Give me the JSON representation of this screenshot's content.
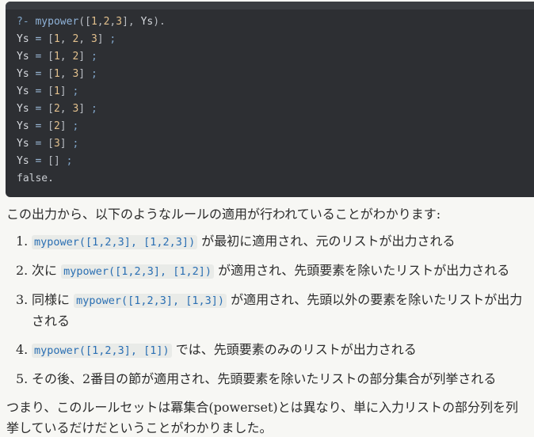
{
  "code": {
    "lines": [
      [
        {
          "c": "tk-prompt",
          "t": "?- "
        },
        {
          "c": "tk-fn",
          "t": "mypower"
        },
        {
          "c": "tk-punc",
          "t": "(["
        },
        {
          "c": "tk-num",
          "t": "1"
        },
        {
          "c": "tk-punc",
          "t": ","
        },
        {
          "c": "tk-num",
          "t": "2"
        },
        {
          "c": "tk-punc",
          "t": ","
        },
        {
          "c": "tk-num",
          "t": "3"
        },
        {
          "c": "tk-punc",
          "t": "], "
        },
        {
          "c": "tk-var",
          "t": "Ys"
        },
        {
          "c": "tk-punc",
          "t": ")."
        }
      ],
      [
        {
          "c": "tk-var",
          "t": "Ys"
        },
        {
          "c": "tk-op",
          "t": " = "
        },
        {
          "c": "tk-punc",
          "t": "["
        },
        {
          "c": "tk-num",
          "t": "1"
        },
        {
          "c": "tk-punc",
          "t": ", "
        },
        {
          "c": "tk-num",
          "t": "2"
        },
        {
          "c": "tk-punc",
          "t": ", "
        },
        {
          "c": "tk-num",
          "t": "3"
        },
        {
          "c": "tk-punc",
          "t": "] "
        },
        {
          "c": "tk-semi",
          "t": ";"
        }
      ],
      [
        {
          "c": "tk-var",
          "t": "Ys"
        },
        {
          "c": "tk-op",
          "t": " = "
        },
        {
          "c": "tk-punc",
          "t": "["
        },
        {
          "c": "tk-num",
          "t": "1"
        },
        {
          "c": "tk-punc",
          "t": ", "
        },
        {
          "c": "tk-num",
          "t": "2"
        },
        {
          "c": "tk-punc",
          "t": "] "
        },
        {
          "c": "tk-semi",
          "t": ";"
        }
      ],
      [
        {
          "c": "tk-var",
          "t": "Ys"
        },
        {
          "c": "tk-op",
          "t": " = "
        },
        {
          "c": "tk-punc",
          "t": "["
        },
        {
          "c": "tk-num",
          "t": "1"
        },
        {
          "c": "tk-punc",
          "t": ", "
        },
        {
          "c": "tk-num",
          "t": "3"
        },
        {
          "c": "tk-punc",
          "t": "] "
        },
        {
          "c": "tk-semi",
          "t": ";"
        }
      ],
      [
        {
          "c": "tk-var",
          "t": "Ys"
        },
        {
          "c": "tk-op",
          "t": " = "
        },
        {
          "c": "tk-punc",
          "t": "["
        },
        {
          "c": "tk-num",
          "t": "1"
        },
        {
          "c": "tk-punc",
          "t": "] "
        },
        {
          "c": "tk-semi",
          "t": ";"
        }
      ],
      [
        {
          "c": "tk-var",
          "t": "Ys"
        },
        {
          "c": "tk-op",
          "t": " = "
        },
        {
          "c": "tk-punc",
          "t": "["
        },
        {
          "c": "tk-num",
          "t": "2"
        },
        {
          "c": "tk-punc",
          "t": ", "
        },
        {
          "c": "tk-num",
          "t": "3"
        },
        {
          "c": "tk-punc",
          "t": "] "
        },
        {
          "c": "tk-semi",
          "t": ";"
        }
      ],
      [
        {
          "c": "tk-var",
          "t": "Ys"
        },
        {
          "c": "tk-op",
          "t": " = "
        },
        {
          "c": "tk-punc",
          "t": "["
        },
        {
          "c": "tk-num",
          "t": "2"
        },
        {
          "c": "tk-punc",
          "t": "] "
        },
        {
          "c": "tk-semi",
          "t": ";"
        }
      ],
      [
        {
          "c": "tk-var",
          "t": "Ys"
        },
        {
          "c": "tk-op",
          "t": " = "
        },
        {
          "c": "tk-punc",
          "t": "["
        },
        {
          "c": "tk-num",
          "t": "3"
        },
        {
          "c": "tk-punc",
          "t": "] "
        },
        {
          "c": "tk-semi",
          "t": ";"
        }
      ],
      [
        {
          "c": "tk-var",
          "t": "Ys"
        },
        {
          "c": "tk-op",
          "t": " = "
        },
        {
          "c": "tk-punc",
          "t": "[] "
        },
        {
          "c": "tk-semi",
          "t": ";"
        }
      ],
      [
        {
          "c": "tk-false",
          "t": "false."
        }
      ]
    ]
  },
  "intro": "この出力から、以下のようなルールの適用が行われていることがわかります:",
  "items": [
    {
      "num": "1.",
      "before": "",
      "code": "mypower([1,2,3], [1,2,3])",
      "after": " が最初に適用され、元のリストが出力される"
    },
    {
      "num": "2.",
      "before": "次に ",
      "code": "mypower([1,2,3], [1,2])",
      "after": " が適用され、先頭要素を除いたリストが出力される"
    },
    {
      "num": "3.",
      "before": "同様に ",
      "code": "mypower([1,2,3], [1,3])",
      "after": " が適用され、先頭以外の要素を除いたリストが出力される"
    },
    {
      "num": "4.",
      "before": "",
      "code": "mypower([1,2,3], [1])",
      "after": " では、先頭要素のみのリストが出力される"
    },
    {
      "num": "5.",
      "before": "その後、2番目の節が適用され、先頭要素を除いたリストの部分集合が列挙される",
      "code": "",
      "after": ""
    }
  ],
  "outro": "つまり、このルールセットは冪集合(powerset)とは異なり、単に入力リストの部分列を列挙しているだけだということがわかりました。",
  "colors": {
    "code_bg": "#2d2f33",
    "inline_code_fg": "#2a6fb3",
    "inline_code_bg": "#e9ebe8",
    "page_bg": "#f7f7f4"
  }
}
